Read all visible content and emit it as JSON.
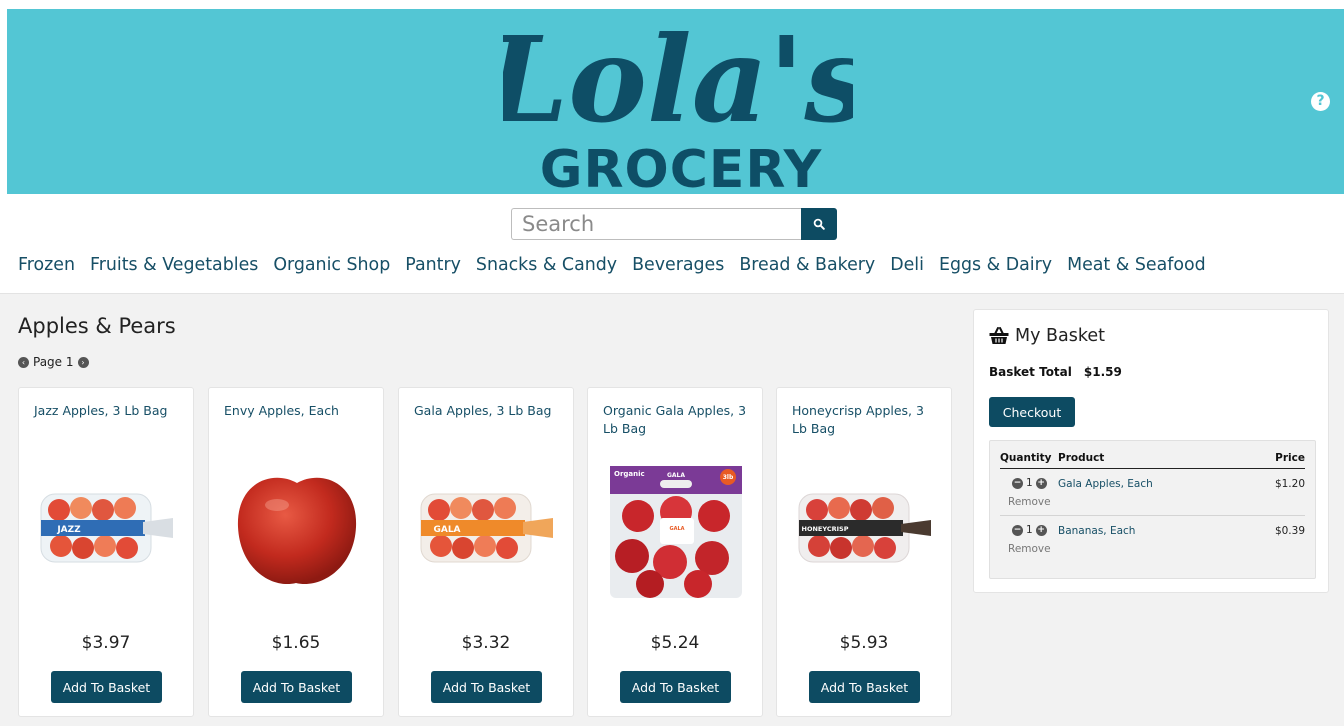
{
  "header": {
    "logo_script": "Lola's",
    "logo_word": "GROCERY",
    "help": "?"
  },
  "search": {
    "placeholder": "Search"
  },
  "categories": [
    "Frozen",
    "Fruits & Vegetables",
    "Organic Shop",
    "Pantry",
    "Snacks & Candy",
    "Beverages",
    "Bread & Bakery",
    "Deli",
    "Eggs & Dairy",
    "Meat & Seafood"
  ],
  "section": {
    "title": "Apples & Pears",
    "page_label": "Page 1"
  },
  "products": [
    {
      "name": "Jazz Apples, 3 Lb Bag",
      "price": "$3.97",
      "button": "Add To Basket",
      "bag_label": "JAZZ",
      "bag_color": "#2f6db5"
    },
    {
      "name": "Envy Apples, Each",
      "price": "$1.65",
      "button": "Add To Basket"
    },
    {
      "name": "Gala Apples, 3 Lb Bag",
      "price": "$3.32",
      "button": "Add To Basket",
      "bag_label": "GALA",
      "bag_color": "#ef8a2a"
    },
    {
      "name": "Organic Gala Apples, 3 Lb Bag",
      "price": "$5.24",
      "button": "Add To Basket",
      "bag_label": "GALA",
      "bag_top": "Organic",
      "bag_size": "3lb"
    },
    {
      "name": "Honeycrisp Apples, 3 Lb Bag",
      "price": "$5.93",
      "button": "Add To Basket",
      "bag_label": "HONEYCRISP",
      "bag_color": "#2b2b2b"
    }
  ],
  "basket": {
    "title": "My Basket",
    "total_label": "Basket Total",
    "total": "$1.59",
    "checkout": "Checkout",
    "headers": {
      "quantity": "Quantity",
      "product": "Product",
      "price": "Price"
    },
    "items": [
      {
        "qty": "1",
        "product": "Gala Apples, Each",
        "price": "$1.20",
        "remove": "Remove"
      },
      {
        "qty": "1",
        "product": "Bananas, Each",
        "price": "$0.39",
        "remove": "Remove"
      }
    ]
  },
  "colors": {
    "banner": "#53c6d4",
    "brand_dark": "#0d4b62",
    "link": "#174f66",
    "main_bg": "#f2f2f2"
  }
}
